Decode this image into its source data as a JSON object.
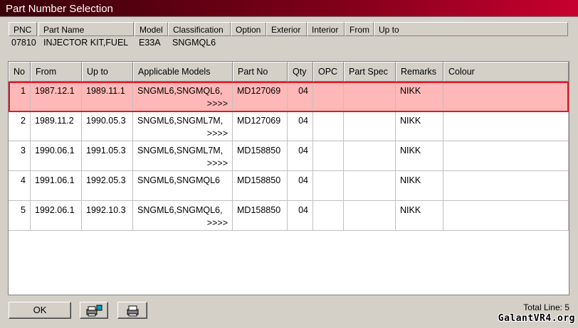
{
  "window": {
    "title": "Part Number Selection"
  },
  "header": {
    "columns": [
      "PNC",
      "Part Name",
      "Model",
      "Classification",
      "Option",
      "Exterior",
      "Interior",
      "From",
      "Up to"
    ],
    "values": {
      "pnc": "07810",
      "part_name": "INJECTOR KIT,FUEL",
      "model": "E33A",
      "classification": "SNGMQL6"
    }
  },
  "table": {
    "columns": [
      "No",
      "From",
      "Up to",
      "Applicable Models",
      "Part No",
      "Qty",
      "OPC",
      "Part Spec",
      "Remarks",
      "Colour"
    ],
    "rows": [
      {
        "no": "1",
        "from": "1987.12.1",
        "upto": "1989.11.1",
        "models": "SNGML6,SNGMQL6,",
        "more": ">>>>",
        "partno": "MD127069",
        "qty": "04",
        "opc": "",
        "spec": "",
        "remarks": "NIKK",
        "colour": ""
      },
      {
        "no": "2",
        "from": "1989.11.2",
        "upto": "1990.05.3",
        "models": "SNGML6,SNGML7M,",
        "more": ">>>>",
        "partno": "MD127069",
        "qty": "04",
        "opc": "",
        "spec": "",
        "remarks": "NIKK",
        "colour": ""
      },
      {
        "no": "3",
        "from": "1990.06.1",
        "upto": "1991.05.3",
        "models": "SNGML6,SNGML7M,",
        "more": ">>>>",
        "partno": "MD158850",
        "qty": "04",
        "opc": "",
        "spec": "",
        "remarks": "NIKK",
        "colour": ""
      },
      {
        "no": "4",
        "from": "1991.06.1",
        "upto": "1992.05.3",
        "models": "SNGML6,SNGMQL6",
        "more": "",
        "partno": "MD158850",
        "qty": "04",
        "opc": "",
        "spec": "",
        "remarks": "NIKK",
        "colour": ""
      },
      {
        "no": "5",
        "from": "1992.06.1",
        "upto": "1992.10.3",
        "models": "SNGML6,SNGMQL6,",
        "more": ">>>>",
        "partno": "MD158850",
        "qty": "04",
        "opc": "",
        "spec": "",
        "remarks": "NIKK",
        "colour": ""
      }
    ]
  },
  "footer": {
    "ok_label": "OK",
    "total_label": "Total Line: 5",
    "watermark": "GalantVR4.org"
  },
  "colors": {
    "title_start": "#3a0008",
    "title_end": "#c80030",
    "selection_fill": "#ffb8b8",
    "selection_border": "#e0182a"
  }
}
